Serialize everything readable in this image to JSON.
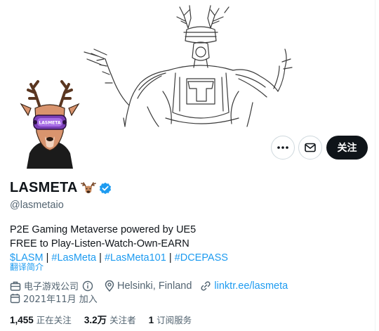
{
  "profile": {
    "display_name": "LASMETA",
    "handle": "@lasmetaio",
    "avatar_screen_text": "LASMETA"
  },
  "actions": {
    "follow_label": "关注"
  },
  "bio": {
    "line1": "P2E Gaming Metaverse powered by UE5",
    "line2": "FREE to Play-Listen-Watch-Own-EARN",
    "tags": [
      "$LASM",
      "#LasMeta",
      "#LasMeta101",
      "#DCEPASS"
    ],
    "separator": "|",
    "translate_label": "翻译简介"
  },
  "meta": {
    "category": "电子游戏公司",
    "location": "Helsinki, Finland",
    "website": "linktr.ee/lasmeta",
    "joined": "2021年11月 加入"
  },
  "stats": [
    {
      "value": "1,455",
      "label": "正在关注"
    },
    {
      "value": "3.2万",
      "label": "关注者"
    },
    {
      "value": "1",
      "label": "订阅服务"
    }
  ],
  "colors": {
    "accent": "#1d9bf0",
    "text": "#0f1419",
    "muted": "#536471",
    "verified": "#1d9bf0"
  }
}
